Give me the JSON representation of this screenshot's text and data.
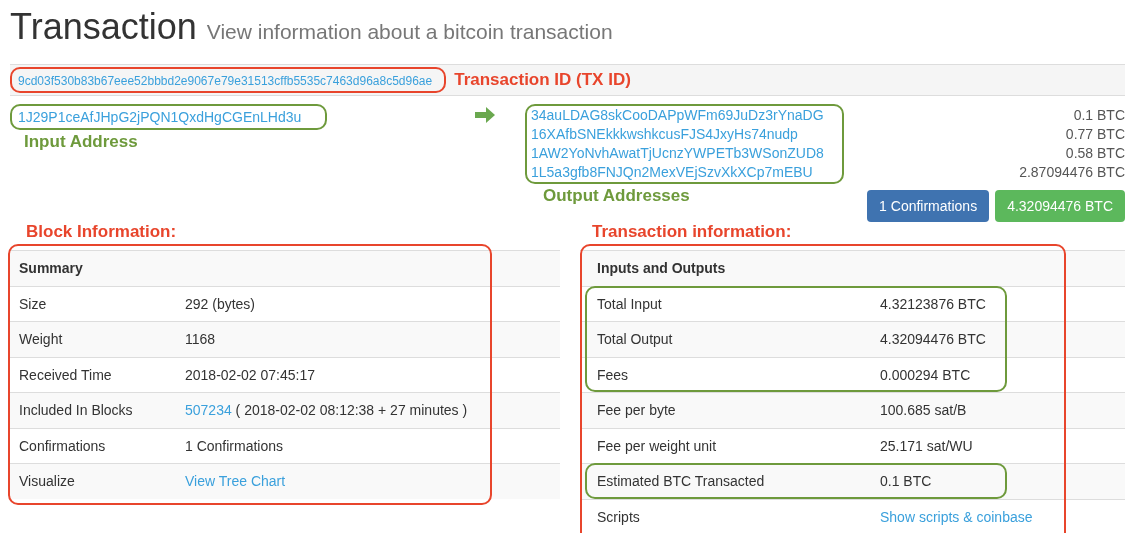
{
  "header": {
    "title": "Transaction",
    "subtitle": "View information about a bitcoin transaction"
  },
  "txid": {
    "value": "9cd03f530b83b67eee52bbbd2e9067e79e31513cffb5535c7463d96a8c5d96ae",
    "annotation": "Transaction ID (TX ID)",
    "color": "#e8452c"
  },
  "input": {
    "address": "1J29P1ceAfJHpG2jPQN1QxdHgCGEnLHd3u",
    "annotation": "Input Address",
    "color": "#6e9a3c"
  },
  "outputs": {
    "annotation": "Output Addresses",
    "color": "#6e9a3c",
    "items": [
      {
        "address": "34auLDAG8skCooDAPpWFm69JuDz3rYnaDG",
        "amount": "0.1 BTC"
      },
      {
        "address": "16XAfbSNEkkkwshkcusFJS4JxyHs74nudp",
        "amount": "0.77 BTC"
      },
      {
        "address": "1AW2YoNvhAwatTjUcnzYWPETb3WSonZUD8",
        "amount": "0.58 BTC"
      },
      {
        "address": "1L5a3gfb8FNJQn2MexVEjSzvXkXCp7mEBU",
        "amount": "2.87094476 BTC"
      }
    ]
  },
  "badges": [
    {
      "label": "1 Confirmations",
      "color": "#3f73b0"
    },
    {
      "label": "4.32094476 BTC",
      "color": "#5cb85c"
    }
  ],
  "block_info": {
    "annotation": "Block Information:",
    "color": "#e8452c",
    "heading": "Summary",
    "rows": [
      {
        "label": "Size",
        "kind": "text",
        "value": "292 (bytes)"
      },
      {
        "label": "Weight",
        "kind": "text",
        "value": "1168"
      },
      {
        "label": "Received Time",
        "kind": "text",
        "value": "2018-02-02 07:45:17"
      },
      {
        "label": "Included In Blocks",
        "kind": "link_note",
        "value": "507234",
        "note": "( 2018-02-02 08:12:38 + 27 minutes )"
      },
      {
        "label": "Confirmations",
        "kind": "text",
        "value": "1 Confirmations"
      },
      {
        "label": "Visualize",
        "kind": "link",
        "value": "View Tree Chart"
      }
    ]
  },
  "transaction_info": {
    "annotation": "Transaction information:",
    "color": "#e8452c",
    "heading": "Inputs and Outputs",
    "sections": [
      {
        "highlighted": true,
        "rows": [
          {
            "label": "Total Input",
            "kind": "text",
            "value": "4.32123876 BTC"
          },
          {
            "label": "Total Output",
            "kind": "text",
            "value": "4.32094476 BTC"
          },
          {
            "label": "Fees",
            "kind": "text",
            "value": "0.000294 BTC"
          }
        ]
      },
      {
        "highlighted": false,
        "rows": [
          {
            "label": "Fee per byte",
            "kind": "text",
            "value": "100.685 sat/B"
          },
          {
            "label": "Fee per weight unit",
            "kind": "text",
            "value": "25.171 sat/WU"
          }
        ]
      },
      {
        "highlighted": true,
        "rows": [
          {
            "label": "Estimated BTC Transacted",
            "kind": "text",
            "value": "0.1 BTC"
          }
        ]
      },
      {
        "highlighted": false,
        "rows": [
          {
            "label": "Scripts",
            "kind": "link",
            "value": "Show scripts & coinbase"
          }
        ]
      }
    ]
  }
}
